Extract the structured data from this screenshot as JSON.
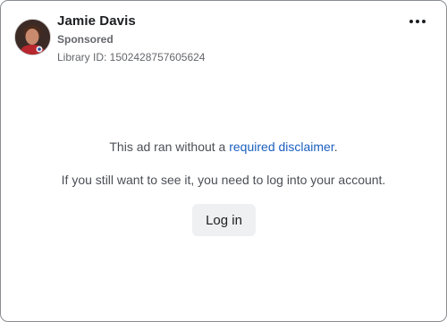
{
  "ad": {
    "advertiser_name": "Jamie Davis",
    "sponsored_label": "Sponsored",
    "library_id": "Library ID: 1502428757605624",
    "menu_icon": "more-horizontal-icon",
    "avatar_icon": "profile-photo"
  },
  "notice": {
    "text_before_link": "This ad ran without a ",
    "link_text": "required disclaimer",
    "text_after_link": ".",
    "login_message": "If you still want to see it, you need to log into your account."
  },
  "actions": {
    "login_label": "Log in"
  },
  "colors": {
    "link": "#1b5fbf",
    "secondary_text": "#65676b",
    "button_bg": "#eef0f2",
    "border": "#8a8d91"
  }
}
